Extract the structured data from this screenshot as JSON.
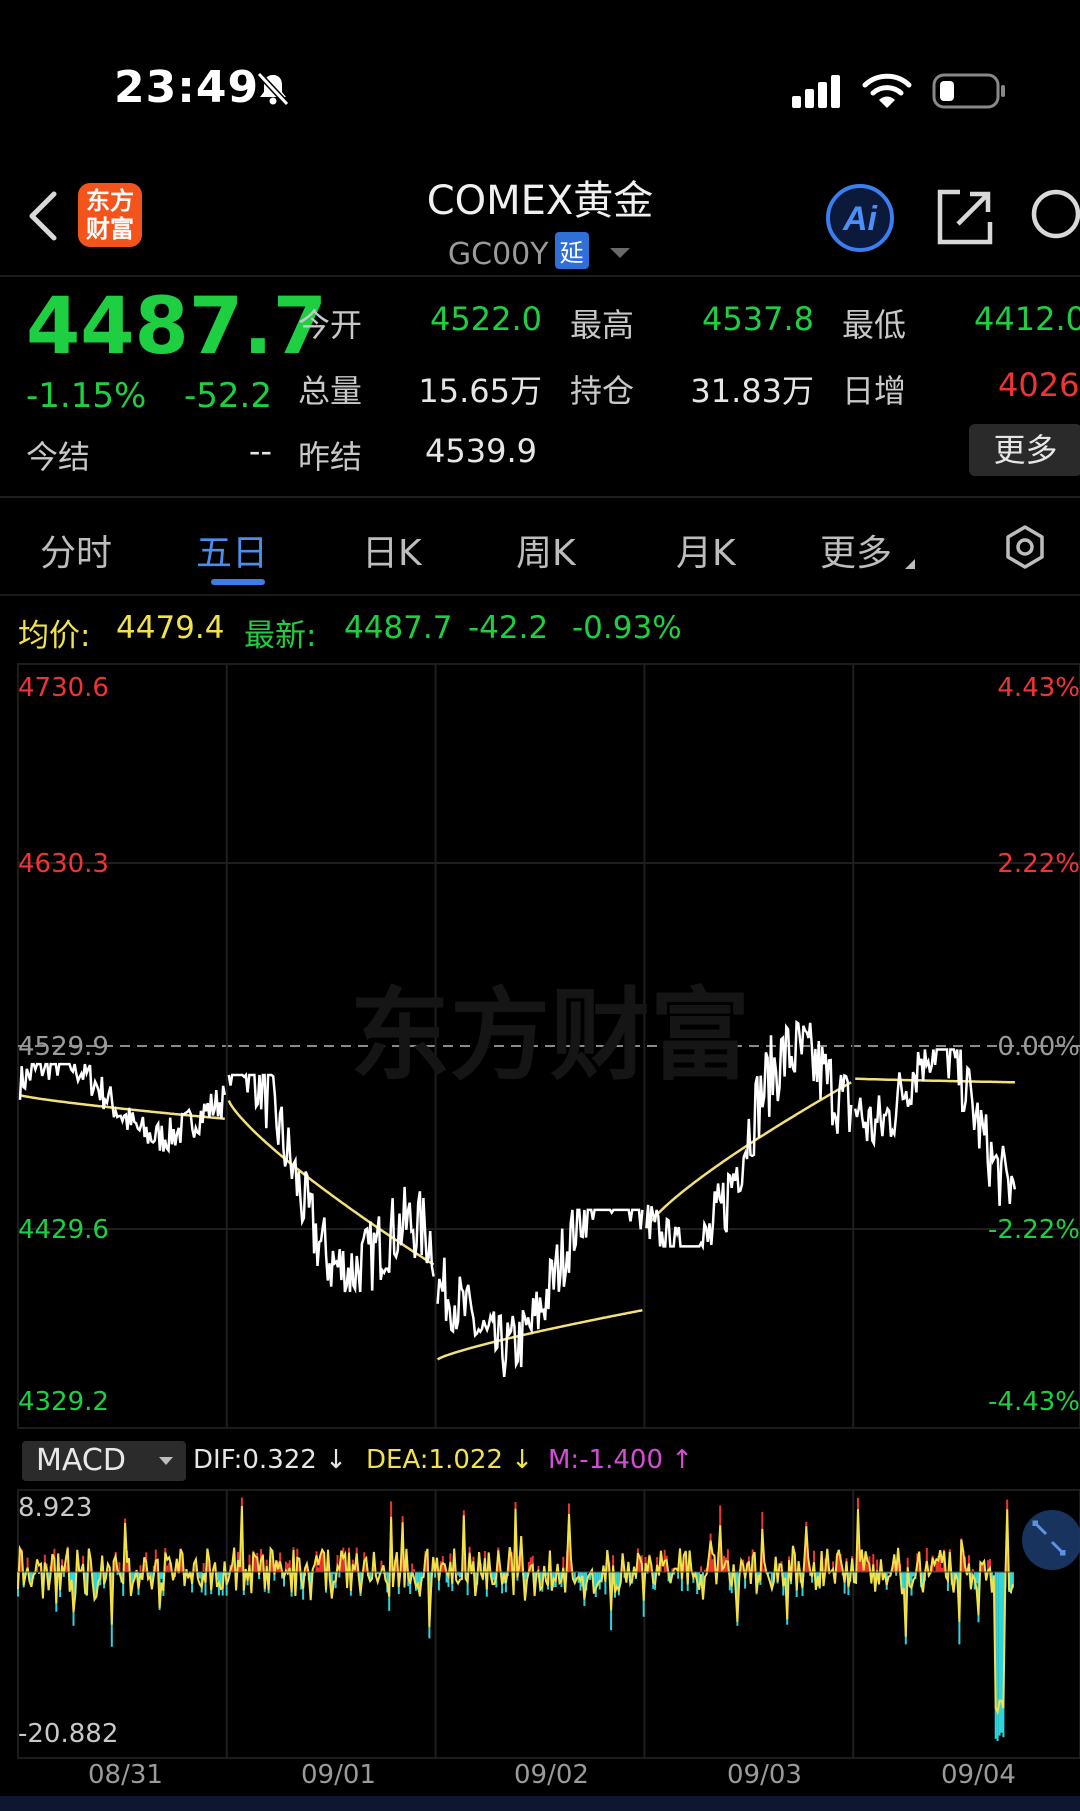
{
  "status_bar": {
    "time": "23:49"
  },
  "header": {
    "logo_text": "东方\n财富",
    "title": "COMEX黄金",
    "code": "GC00Y",
    "delay_badge": "延"
  },
  "quote": {
    "price": "4487.7",
    "change_pct": "-1.15%",
    "change": "-52.2",
    "fields": [
      {
        "label": "今开",
        "value": "4522.0",
        "color": "green"
      },
      {
        "label": "最高",
        "value": "4537.8",
        "color": "green"
      },
      {
        "label": "最低",
        "value": "4412.0",
        "color": "green"
      },
      {
        "label": "总量",
        "value": "15.65万",
        "color": "white"
      },
      {
        "label": "持仓",
        "value": "31.83万",
        "color": "white"
      },
      {
        "label": "日增",
        "value": "4026",
        "color": "red"
      },
      {
        "label": "今结",
        "value": "--",
        "color": "white"
      },
      {
        "label": "昨结",
        "value": "4539.9",
        "color": "white"
      }
    ],
    "more_label": "更多"
  },
  "tabs": [
    "分时",
    "五日",
    "日K",
    "周K",
    "月K",
    "更多"
  ],
  "active_tab": "五日",
  "info_line": {
    "avg_label": "均价:",
    "avg_value": "4479.4",
    "latest_label": "最新:",
    "latest_value": "4487.7",
    "latest_change": "-42.2",
    "latest_pct": "-0.93%"
  },
  "watermark": "东方财富",
  "chart_data": [
    {
      "type": "line",
      "y_left_ticks": [
        "4730.6",
        "4630.3",
        "4529.9",
        "4429.6",
        "4329.2"
      ],
      "y_right_ticks": [
        "4.43%",
        "2.22%",
        "0.00%",
        "-2.22%",
        "-4.43%"
      ],
      "ylim": [
        4329.2,
        4730.6
      ],
      "reference": 4529.9,
      "x_labels": [
        "08/31",
        "09/01",
        "09/02",
        "09/03",
        "09/04"
      ],
      "days": [
        {
          "price_start": 4510,
          "price_end": 4488,
          "price_min": 4465,
          "price_max": 4520,
          "avg_start": 4503,
          "avg_end": 4490,
          "close_frac": 1.0
        },
        {
          "price_start": 4500,
          "price_end": 4390,
          "price_min": 4395,
          "price_max": 4514,
          "avg_start": 4500,
          "avg_end": 4410,
          "close_frac": 1.0
        },
        {
          "price_start": 4370,
          "price_end": 4437,
          "price_min": 4334,
          "price_max": 4440,
          "avg_start": 4358,
          "avg_end": 4385,
          "close_frac": 1.0
        },
        {
          "price_start": 4425,
          "price_end": 4520,
          "price_min": 4420,
          "price_max": 4545,
          "avg_start": 4430,
          "avg_end": 4510,
          "close_frac": 1.0
        },
        {
          "price_start": 4520,
          "price_end": 4483,
          "price_min": 4420,
          "price_max": 4528,
          "avg_start": 4512,
          "avg_end": 4510,
          "close_frac": 0.78
        }
      ],
      "series": [
        {
          "name": "均价",
          "color": "#f2e07a"
        },
        {
          "name": "最新",
          "color": "#ffffff"
        }
      ]
    },
    {
      "type": "bar",
      "indicator": "MACD",
      "ylim": [
        -20.882,
        8.923
      ],
      "y_ticks": [
        "8.923",
        "-20.882"
      ],
      "dif": "DIF:0.322 ↓",
      "dea": "DEA:1.022 ↓",
      "m": "M:-1.400 ↑"
    }
  ]
}
